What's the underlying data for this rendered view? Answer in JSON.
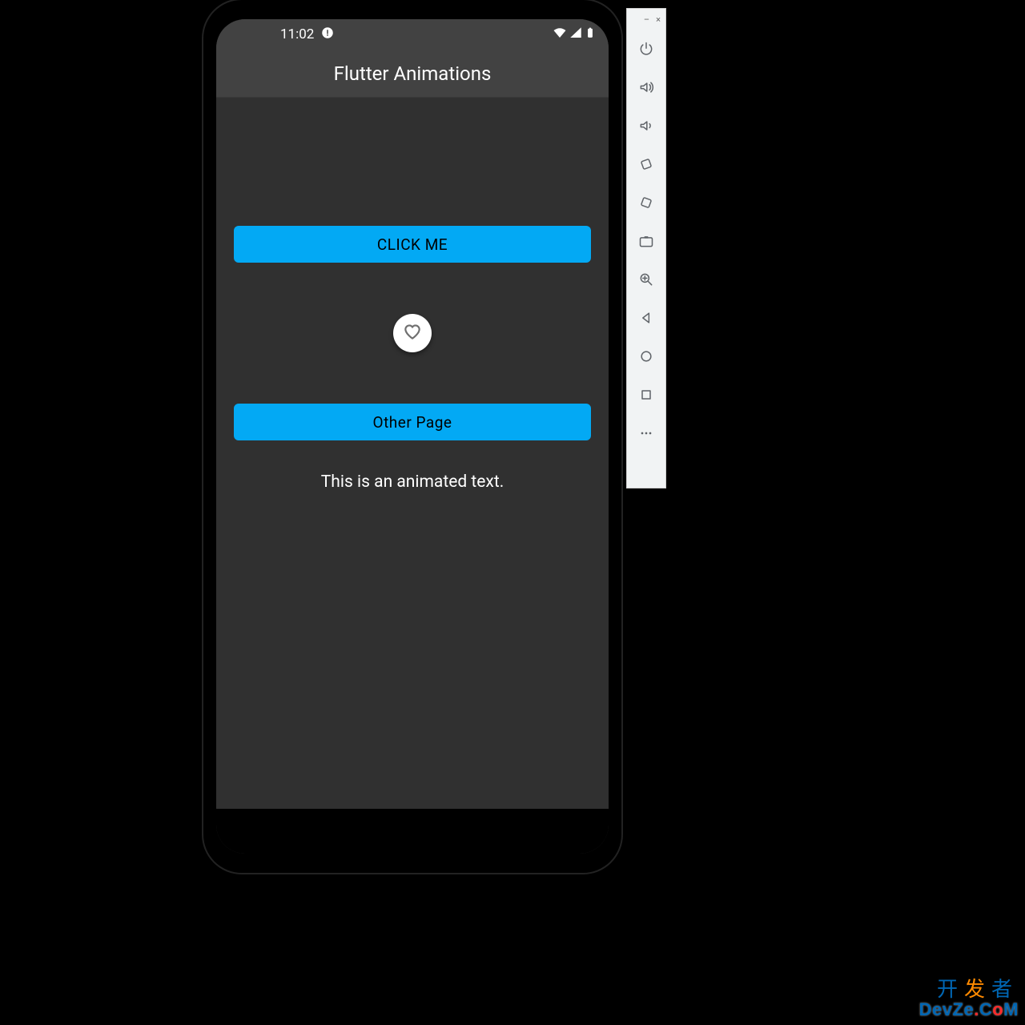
{
  "status": {
    "time": "11:02",
    "wifi_icon": "wifi-icon",
    "signal_icon": "signal-icon",
    "battery_icon": "battery-icon",
    "debug_icon": "debug-icon"
  },
  "appbar": {
    "title": "Flutter Animations"
  },
  "body": {
    "click_button_label": "CLICK ME",
    "other_page_button_label": "Other Page",
    "animated_text": "This is an animated text."
  },
  "emulator_toolbar": {
    "window_controls": {
      "minimize": "–",
      "close": "×"
    },
    "buttons": [
      {
        "name": "power-icon"
      },
      {
        "name": "volume-up-icon"
      },
      {
        "name": "volume-down-icon"
      },
      {
        "name": "rotate-left-icon"
      },
      {
        "name": "rotate-right-icon"
      },
      {
        "name": "camera-icon"
      },
      {
        "name": "zoom-icon"
      },
      {
        "name": "back-icon"
      },
      {
        "name": "home-icon"
      },
      {
        "name": "overview-icon"
      },
      {
        "name": "more-icon"
      }
    ]
  },
  "watermark": {
    "line1_a": "开",
    "line1_b": "发",
    "line1_c": "者",
    "line2_prefix": "DevZe",
    "line2_dot": ".",
    "line2_com_c": "C",
    "line2_com_o": "o",
    "line2_com_m": "M"
  },
  "colors": {
    "accent": "#03A9F4",
    "scaffold": "#303030",
    "appbar": "#424242"
  }
}
